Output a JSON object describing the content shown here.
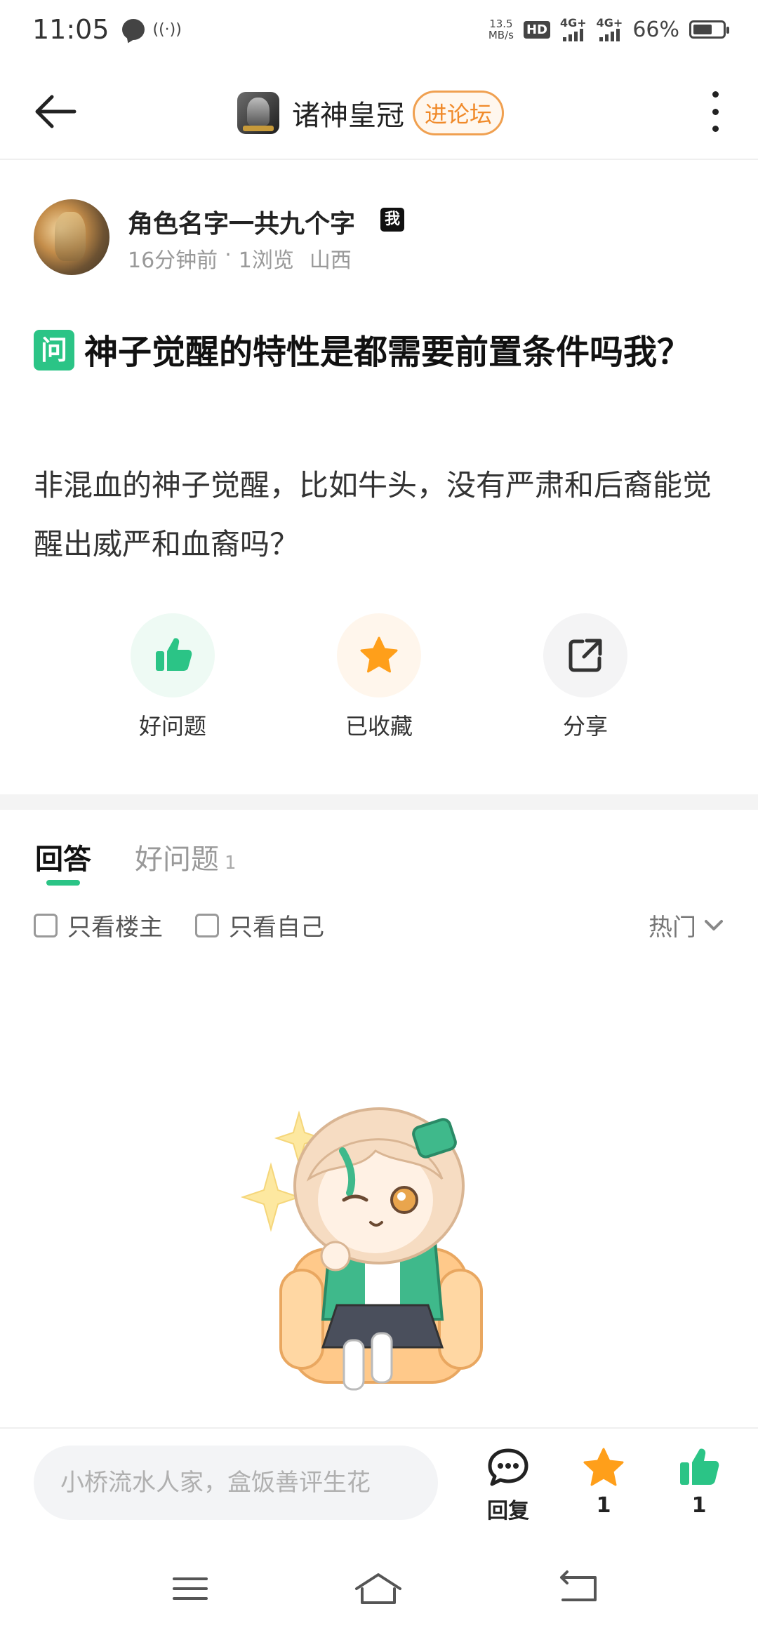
{
  "status_bar": {
    "time": "11:05",
    "speed_value": "13.5",
    "speed_unit": "MB/s",
    "hd_label": "HD",
    "sim1_label": "4G+",
    "sim2_label": "4G+",
    "battery_percent": "66%",
    "battery_level": 0.66
  },
  "header": {
    "forum_name": "诸神皇冠",
    "enter_forum_label": "进论坛"
  },
  "author": {
    "name": "角色名字一共九个字",
    "me_badge": "我",
    "time_ago": "16分钟前",
    "separator": "·",
    "views": "1浏览",
    "location": "山西"
  },
  "question": {
    "badge": "问",
    "title": "神子觉醒的特性是都需要前置条件吗我？",
    "body": "非混血的神子觉醒，比如牛头，没有严肃和后裔能觉醒出威严和血裔吗？"
  },
  "actions": {
    "good_question_label": "好问题",
    "collected_label": "已收藏",
    "share_label": "分享"
  },
  "tabs": {
    "answers_label": "回答",
    "good_question_label": "好问题",
    "good_question_count": "1"
  },
  "filters": {
    "only_op_label": "只看楼主",
    "only_me_label": "只看自己",
    "sort_label": "热门"
  },
  "bottom_bar": {
    "input_placeholder": "小桥流水人家，盒饭善评生花",
    "reply_label": "回复",
    "favorite_count": "1",
    "like_count": "1"
  },
  "colors": {
    "accent_green": "#2bc486",
    "accent_orange": "#f08a2a",
    "star_orange": "#ff9f1a"
  }
}
